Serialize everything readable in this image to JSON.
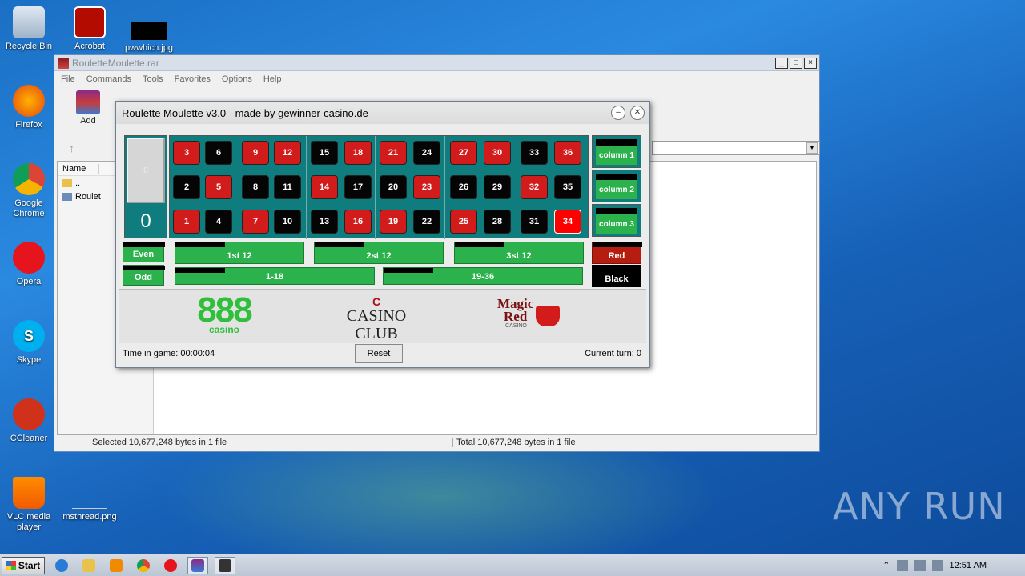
{
  "desktop": {
    "icons": [
      {
        "label": "Recycle Bin"
      },
      {
        "label": "Acrobat"
      },
      {
        "label": "pwwhich.jpg"
      },
      {
        "label": "Firefox"
      },
      {
        "label": "Google Chrome"
      },
      {
        "label": "Opera"
      },
      {
        "label": "Skype"
      },
      {
        "label": "CCleaner"
      },
      {
        "label": "VLC media player"
      },
      {
        "label": "msthread.png"
      }
    ]
  },
  "winrar": {
    "title": "RouletteMoulette.rar",
    "menu": [
      "File",
      "Commands",
      "Tools",
      "Favorites",
      "Options",
      "Help"
    ],
    "toolbar": {
      "add_label": "Add"
    },
    "columns": {
      "name": "Name"
    },
    "files": [
      {
        "name": ".."
      },
      {
        "name": "Roulet"
      }
    ],
    "status": {
      "left": "Selected 10,677,248 bytes in 1 file",
      "right": "Total 10,677,248 bytes in 1 file"
    }
  },
  "roulette": {
    "title": "Roulette Moulette v3.0 - made by gewinner-casino.de",
    "zero_small": "0",
    "zero_big": "0",
    "rows": [
      [
        {
          "n": "3",
          "c": "red"
        },
        {
          "n": "6",
          "c": "black"
        },
        {
          "n": "9",
          "c": "red"
        },
        {
          "n": "12",
          "c": "red"
        },
        {
          "n": "15",
          "c": "black"
        },
        {
          "n": "18",
          "c": "red"
        },
        {
          "n": "21",
          "c": "red"
        },
        {
          "n": "24",
          "c": "black"
        },
        {
          "n": "27",
          "c": "red"
        },
        {
          "n": "30",
          "c": "red"
        },
        {
          "n": "33",
          "c": "black"
        },
        {
          "n": "36",
          "c": "red"
        }
      ],
      [
        {
          "n": "2",
          "c": "black"
        },
        {
          "n": "5",
          "c": "red"
        },
        {
          "n": "8",
          "c": "black"
        },
        {
          "n": "11",
          "c": "black"
        },
        {
          "n": "14",
          "c": "red"
        },
        {
          "n": "17",
          "c": "black"
        },
        {
          "n": "20",
          "c": "black"
        },
        {
          "n": "23",
          "c": "red"
        },
        {
          "n": "26",
          "c": "black"
        },
        {
          "n": "29",
          "c": "black"
        },
        {
          "n": "32",
          "c": "red"
        },
        {
          "n": "35",
          "c": "black"
        }
      ],
      [
        {
          "n": "1",
          "c": "red"
        },
        {
          "n": "4",
          "c": "black"
        },
        {
          "n": "7",
          "c": "red"
        },
        {
          "n": "10",
          "c": "black"
        },
        {
          "n": "13",
          "c": "black"
        },
        {
          "n": "16",
          "c": "red"
        },
        {
          "n": "19",
          "c": "red"
        },
        {
          "n": "22",
          "c": "black"
        },
        {
          "n": "25",
          "c": "red"
        },
        {
          "n": "28",
          "c": "black"
        },
        {
          "n": "31",
          "c": "black"
        },
        {
          "n": "34",
          "c": "hot"
        }
      ]
    ],
    "columns": [
      "column 1",
      "column 2",
      "column 3"
    ],
    "bets": {
      "even": "Even",
      "odd": "Odd",
      "dozen1": "1st 12",
      "dozen2": "2st 12",
      "dozen3": "3st 12",
      "low": "1-18",
      "high": "19-36",
      "red": "Red",
      "black": "Black"
    },
    "logos": {
      "l888": "888",
      "l888_sub": "casino",
      "casino_club_mark": "C",
      "casino_club": "CASINO CLUB",
      "magic": "Magic",
      "red": "Red",
      "casino": "CASINO"
    },
    "status": {
      "time": "Time in game: 00:00:04",
      "reset": "Reset",
      "turn": "Current turn: 0"
    },
    "colors": {
      "table": "#0f7d7d",
      "red": "#d21b1b",
      "black": "#050505",
      "green": "#2bb24c"
    }
  },
  "taskbar": {
    "start": "Start",
    "clock": "12:51 AM"
  },
  "watermark": "ANY RUN"
}
